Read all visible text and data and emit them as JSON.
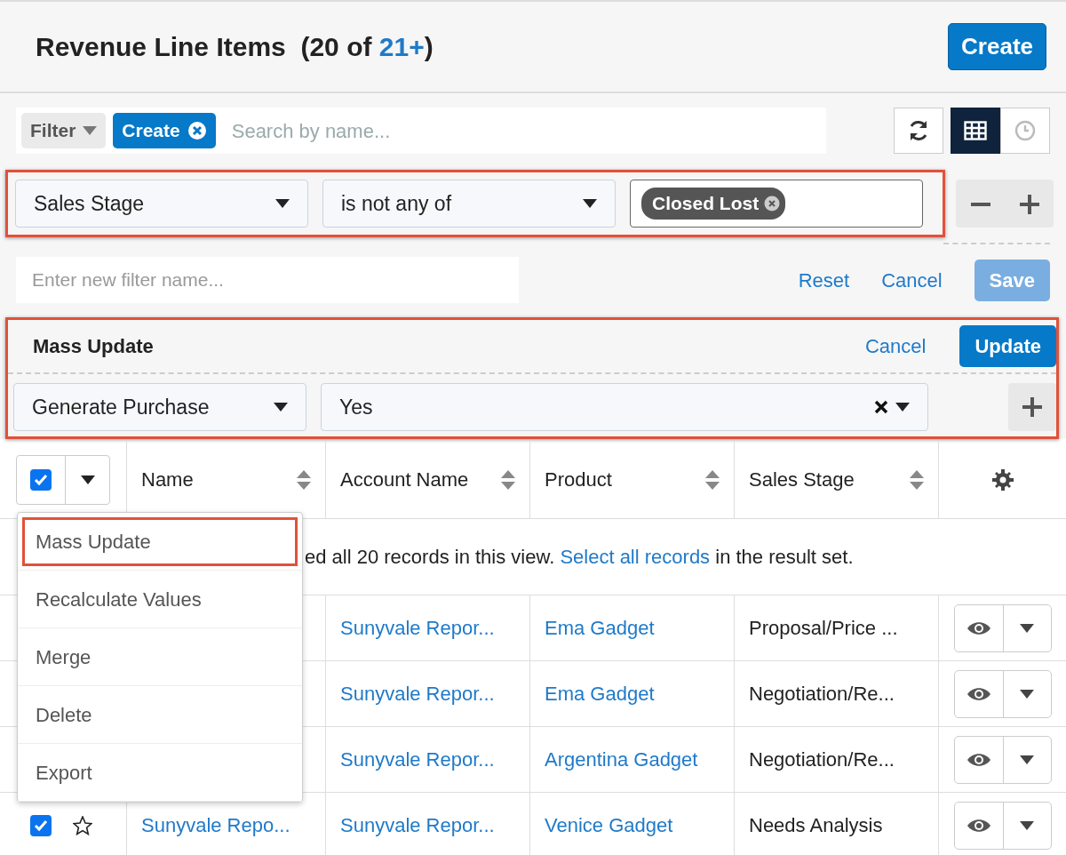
{
  "header": {
    "title": "Revenue Line Items",
    "count_open": "(20 of ",
    "count_link": "21+",
    "count_close": ")",
    "create_button": "Create"
  },
  "filter_bar": {
    "filter_button": "Filter",
    "active_filter": "Create",
    "search": {
      "placeholder": "Search by name..."
    },
    "views": [
      {
        "kind": "list",
        "selected": true
      },
      {
        "kind": "activity",
        "selected": false
      }
    ]
  },
  "filter_rule": {
    "highlighted": true,
    "field": "Sales Stage",
    "operator": "is not any of",
    "values": [
      "Closed Lost"
    ]
  },
  "filter_name": {
    "placeholder": "Enter new filter name...",
    "links": [
      "Reset",
      "Cancel"
    ],
    "save_button": "Save",
    "save_disabled": true
  },
  "mass_update": {
    "highlighted": true,
    "title": "Mass Update",
    "cancel": "Cancel",
    "update_button": "Update",
    "field": "Generate Purchase",
    "value": "Yes"
  },
  "table": {
    "select_all_checked": true,
    "columns": [
      "Name",
      "Account Name",
      "Product",
      "Sales Stage"
    ],
    "notice": {
      "before": "ed all 20 records in this view. ",
      "link": "Select all records",
      "after": " in the result set."
    },
    "rows": [
      {
        "account": "Sunyvale Repor...",
        "product": "Ema Gadget",
        "stage": "Proposal/Price ..."
      },
      {
        "account": "Sunyvale Repor...",
        "product": "Ema Gadget",
        "stage": "Negotiation/Re..."
      },
      {
        "account": "Sunyvale Repor...",
        "product": "Argentina Gadget",
        "stage": "Negotiation/Re..."
      },
      {
        "checked": true,
        "starred": false,
        "name": "Sunyvale Repo...",
        "account": "Sunyvale Repor...",
        "product": "Venice Gadget",
        "stage": "Needs Analysis"
      }
    ]
  },
  "actions_menu": {
    "items": [
      {
        "label": "Mass Update",
        "highlighted": true
      },
      {
        "label": "Recalculate Values",
        "highlighted": false
      },
      {
        "label": "Merge",
        "highlighted": false
      },
      {
        "label": "Delete",
        "highlighted": false
      },
      {
        "label": "Export",
        "highlighted": false
      }
    ]
  }
}
